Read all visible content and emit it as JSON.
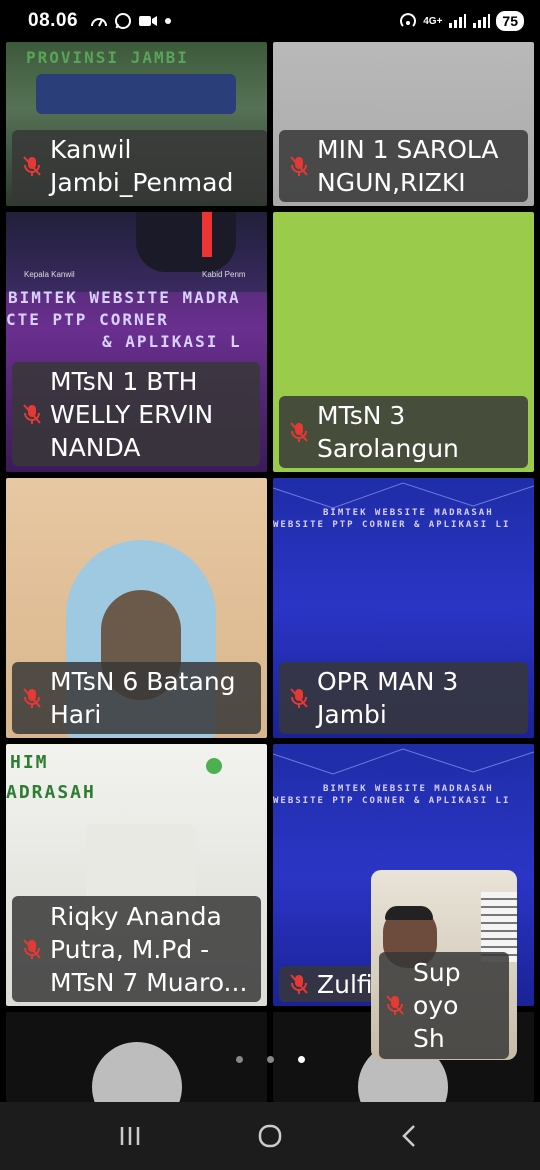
{
  "status_bar": {
    "time": "08.06",
    "network": "4G+",
    "battery": "75"
  },
  "tiles": [
    {
      "name": "Kanwil\nJambi_Penmad",
      "lines": [
        "Kanwil",
        "Jambi_Penmad"
      ],
      "muted": true,
      "banner": "PROVINSI JAMBI"
    },
    {
      "name": "MIN 1 SAROLANGUN,RIZKI",
      "lines": [
        "MIN 1 SAROLA",
        "NGUN,RIZKI"
      ],
      "muted": true
    },
    {
      "name": "MTsN 1 BTH WELLY ERVIN NANDA",
      "lines": [
        "MTsN 1 BTH",
        "WELLY ERVIN",
        "NANDA"
      ],
      "muted": true,
      "banner_lines": [
        "BIMTEK WEBSITE MADRA",
        "CTE PTP CORNER",
        "& APLIKASI L"
      ],
      "caption_left": "Kepala Kanwil",
      "caption_right": "Kabid Penm"
    },
    {
      "name": "MTsN 3 Sarolangun",
      "lines": [
        "MTsN 3",
        "Sarolangun"
      ],
      "muted": true
    },
    {
      "name": "MTsN 6 Batang Hari",
      "lines": [
        "MTsN 6 Batang",
        "Hari"
      ],
      "muted": true
    },
    {
      "name": "OPR MAN 3 Jambi",
      "lines": [
        "OPR MAN 3",
        "Jambi"
      ],
      "muted": true,
      "banner_lines": [
        "BIMTEK WEBSITE MADRASAH",
        "WEBSITE PTP CORNER & APLIKASI LI"
      ]
    },
    {
      "name": "Riqky Ananda Putra, M.Pd - MTsN 7 Muaro...",
      "lines": [
        "Riqky Ananda",
        "Putra, M.Pd -",
        "MTsN 7 Muaro..."
      ],
      "muted": true,
      "banner_lines": [
        "HIM",
        "ADRASAH"
      ]
    },
    {
      "name": "Zulfia",
      "lines": [
        "Zulfia"
      ],
      "muted": true,
      "banner_lines": [
        "BIMTEK WEBSITE MADRASAH",
        "WEBSITE PTP CORNER & APLIKASI LI"
      ]
    }
  ],
  "pip": {
    "lines": [
      "Sup",
      "oyo",
      "Sh"
    ],
    "muted": true
  },
  "pagination": {
    "count": 3,
    "active": 2
  },
  "nav": {
    "recent_icon": "recent-apps-icon",
    "home_icon": "home-icon",
    "back_icon": "back-icon"
  }
}
